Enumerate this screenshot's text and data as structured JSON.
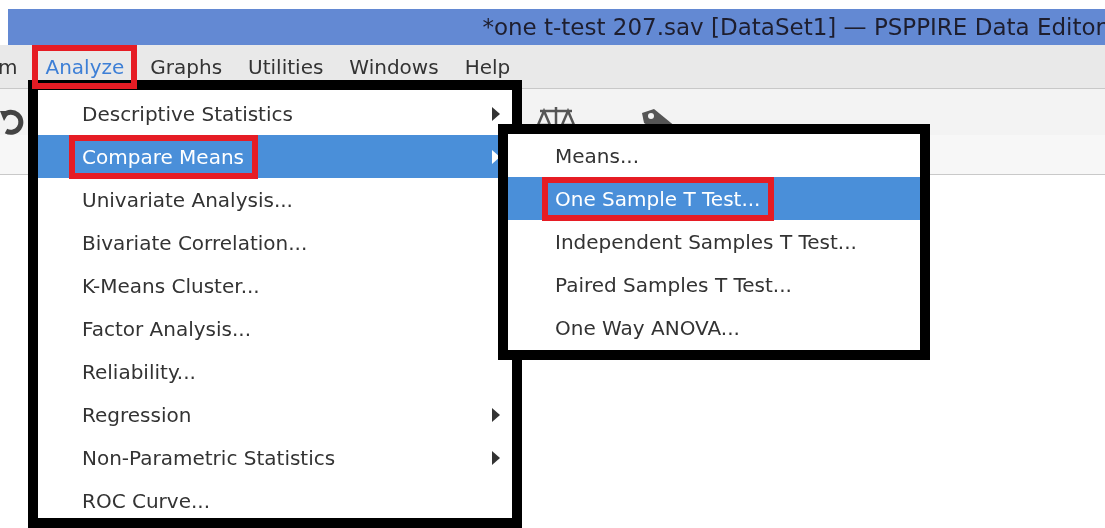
{
  "window": {
    "title": "*one t-test 207.sav [DataSet1] — PSPPIRE Data Editor"
  },
  "menubar": {
    "items": [
      {
        "label": "m",
        "selected": false,
        "marked": false
      },
      {
        "label": "Analyze",
        "selected": true,
        "marked": true
      },
      {
        "label": "Graphs",
        "selected": false,
        "marked": false
      },
      {
        "label": "Utilities",
        "selected": false,
        "marked": false
      },
      {
        "label": "Windows",
        "selected": false,
        "marked": false
      },
      {
        "label": "Help",
        "selected": false,
        "marked": false
      }
    ]
  },
  "menu": {
    "items": [
      {
        "label": "Descriptive Statistics",
        "submenu": true,
        "selected": false,
        "marked": false
      },
      {
        "label": "Compare Means",
        "submenu": true,
        "selected": true,
        "marked": true
      },
      {
        "label": "Univariate Analysis...",
        "submenu": false,
        "selected": false,
        "marked": false
      },
      {
        "label": "Bivariate Correlation...",
        "submenu": false,
        "selected": false,
        "marked": false
      },
      {
        "label": "K-Means Cluster...",
        "submenu": false,
        "selected": false,
        "marked": false
      },
      {
        "label": "Factor Analysis...",
        "submenu": false,
        "selected": false,
        "marked": false
      },
      {
        "label": "Reliability...",
        "submenu": false,
        "selected": false,
        "marked": false
      },
      {
        "label": "Regression",
        "submenu": true,
        "selected": false,
        "marked": false
      },
      {
        "label": "Non-Parametric Statistics",
        "submenu": true,
        "selected": false,
        "marked": false
      },
      {
        "label": "ROC Curve...",
        "submenu": false,
        "selected": false,
        "marked": false
      }
    ]
  },
  "submenu": {
    "items": [
      {
        "label": "Means...",
        "selected": false,
        "marked": false
      },
      {
        "label": "One Sample T Test...",
        "selected": true,
        "marked": true
      },
      {
        "label": "Independent Samples T Test...",
        "selected": false,
        "marked": false
      },
      {
        "label": "Paired Samples T Test...",
        "selected": false,
        "marked": false
      },
      {
        "label": "One Way ANOVA...",
        "selected": false,
        "marked": false
      }
    ]
  }
}
